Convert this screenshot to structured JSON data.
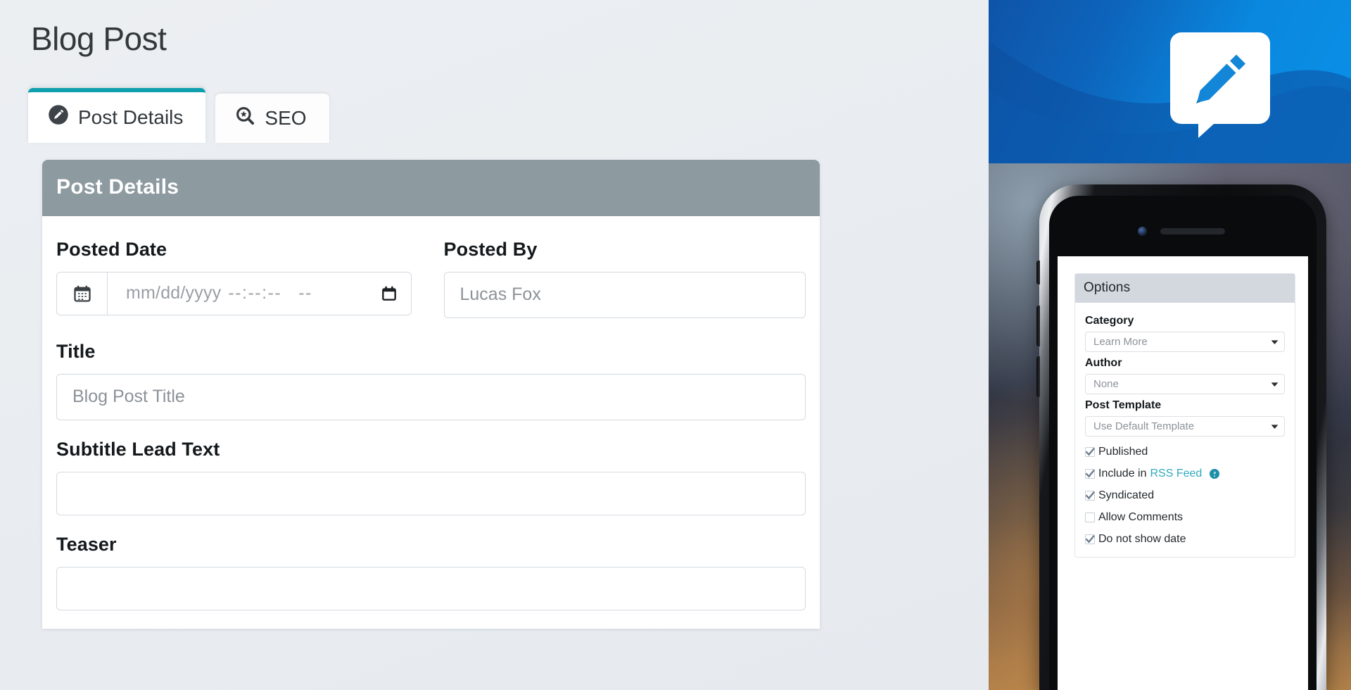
{
  "page": {
    "title": "Blog Post"
  },
  "tabs": [
    {
      "label": "Post Details",
      "icon": "pencil-circle-icon",
      "active": true
    },
    {
      "label": "SEO",
      "icon": "search-star-icon",
      "active": false
    }
  ],
  "card": {
    "header": "Post Details",
    "fields": {
      "posted_date": {
        "label": "Posted Date",
        "date_placeholder": "mm/dd/yyyy",
        "time_placeholder": "--:--:--",
        "ampm_placeholder": "--",
        "addon_icon": "calendar-icon",
        "picker_icon": "calendar-picker-icon",
        "value": ""
      },
      "posted_by": {
        "label": "Posted By",
        "placeholder": "Lucas Fox",
        "value": ""
      },
      "title": {
        "label": "Title",
        "placeholder": "Blog Post Title",
        "value": ""
      },
      "subtitle": {
        "label": "Subtitle Lead Text",
        "placeholder": "",
        "value": ""
      },
      "teaser": {
        "label": "Teaser",
        "placeholder": "",
        "value": ""
      }
    }
  },
  "preview": {
    "banner": {
      "icon": "pencil-speech-bubble-icon",
      "accent": "#0a8ce0",
      "accent_dark": "#0e54a8"
    },
    "options": {
      "header": "Options",
      "selects": [
        {
          "label": "Category",
          "value": "Learn More"
        },
        {
          "label": "Author",
          "value": "None"
        },
        {
          "label": "Post Template",
          "value": "Use Default Template"
        }
      ],
      "checkboxes": [
        {
          "label": "Published",
          "checked": true
        },
        {
          "label": "Include in ",
          "link": "RSS Feed",
          "checked": true,
          "help_icon": "help-circle-icon"
        },
        {
          "label": "Syndicated",
          "checked": true
        },
        {
          "label": "Allow Comments",
          "checked": false
        },
        {
          "label": "Do not show date",
          "checked": true
        }
      ]
    }
  },
  "colors": {
    "tab_accent": "#0f9fae",
    "card_header": "#8d9aa0",
    "link_teal": "#2fa9bd",
    "page_bg": "#eceff2"
  }
}
